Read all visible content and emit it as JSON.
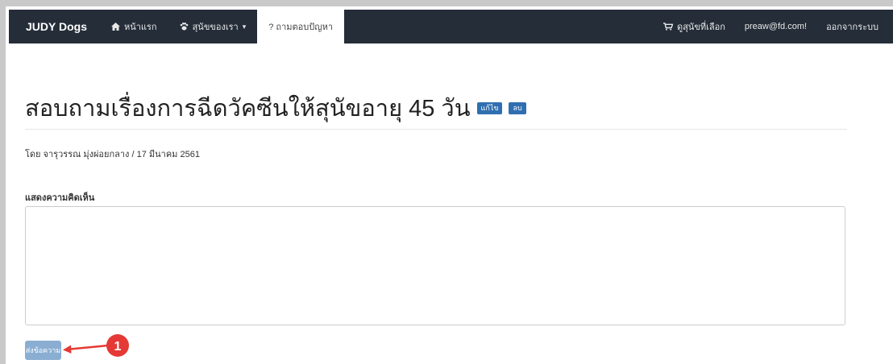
{
  "navbar": {
    "brand": "JUDY Dogs",
    "items": [
      {
        "label": "หน้าแรก",
        "icon": "home-icon"
      },
      {
        "label": "สุนัขของเรา",
        "icon": "paw-icon",
        "dropdown": true
      },
      {
        "label": "? ถามตอบปัญหา",
        "active": true
      }
    ],
    "right": [
      {
        "label": "ดูสุนัขที่เลือก",
        "icon": "cart-icon"
      },
      {
        "label": "preaw@fd.com!"
      },
      {
        "label": "ออกจากระบบ"
      }
    ]
  },
  "main": {
    "title": "สอบถามเรื่องการฉีดวัคซีนให้สุนัขอายุ 45 วัน",
    "edit_tag": "แก้ไข",
    "delete_tag": "ลบ",
    "byline": "โดย จารุวรรณ มุ่งผ่อยกลาง / 17 มีนาคม 2561",
    "comment_label": "แสดงความคิดเห็น",
    "comment_value": "",
    "submit_label": "ส่งข้อความ"
  },
  "annotation": {
    "number": "1",
    "color": "#e53935"
  },
  "colors": {
    "navbar_bg": "#242d38",
    "tag_bg": "#2f6fb0",
    "submit_bg": "#8aaed2"
  }
}
